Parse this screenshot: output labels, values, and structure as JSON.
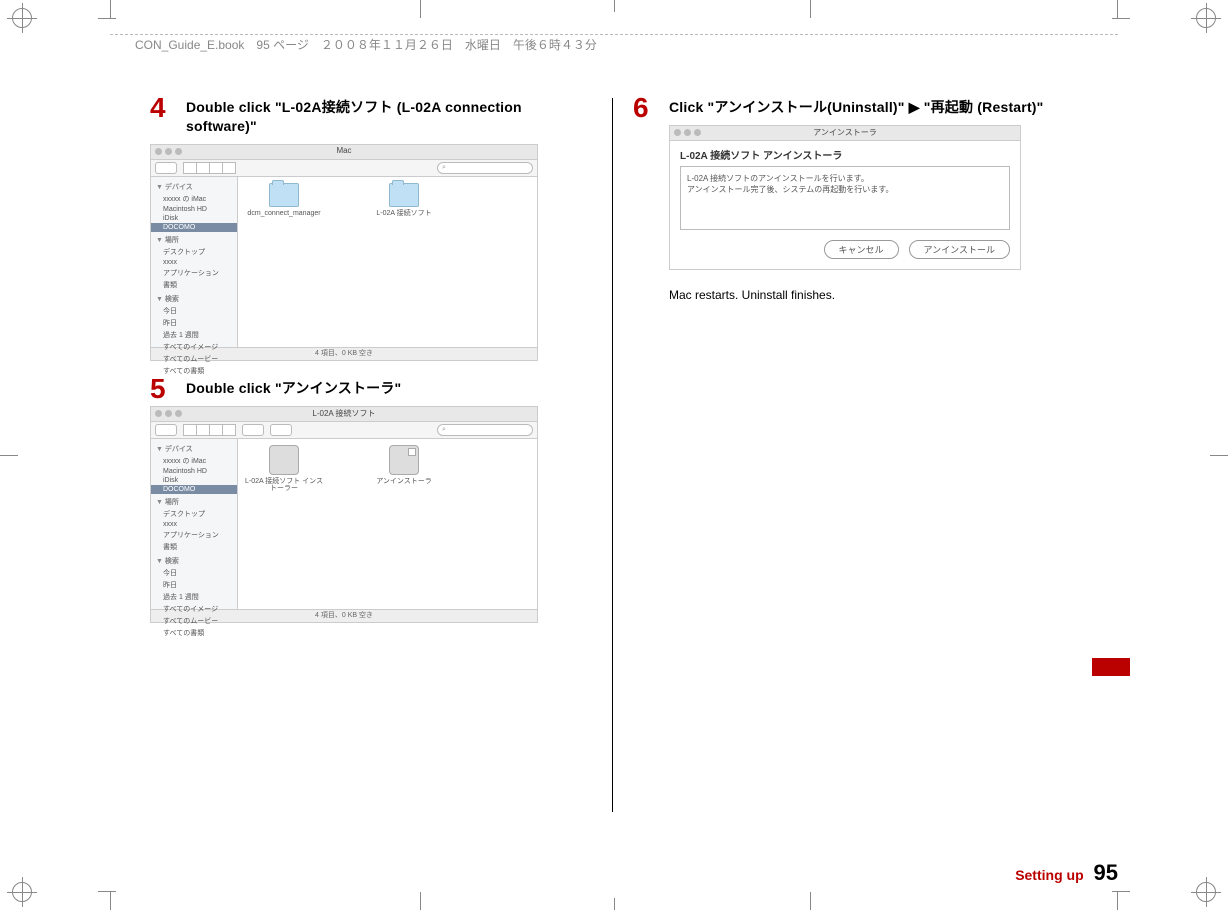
{
  "header_line": "CON_Guide_E.book　95 ページ　２００８年１１月２６日　水曜日　午後６時４３分",
  "steps": {
    "s4": {
      "num": "4",
      "text": "Double click \"L-02A接続ソフト (L-02A connection software)\""
    },
    "s5": {
      "num": "5",
      "text": "Double click \"アンインストーラ\""
    },
    "s6": {
      "num": "6",
      "text": "Click \"アンインストール(Uninstall)\" ▶ \"再起動 (Restart)\""
    }
  },
  "finderA": {
    "title": "Mac",
    "search_glyph": "⌕",
    "side": {
      "devices_hd": "▼ デバイス",
      "dev1": "xxxxx の iMac",
      "dev2": "Macintosh HD",
      "dev3": "iDisk",
      "dev4": "DOCOMO",
      "places_hd": "▼ 場所",
      "pl1": "デスクトップ",
      "pl2": "xxxx",
      "pl3": "アプリケーション",
      "pl4": "書類",
      "search_hd": "▼ 検索",
      "se1": "今日",
      "se2": "昨日",
      "se3": "過去 1 週間",
      "se4": "すべてのイメージ",
      "se5": "すべてのムービー",
      "se6": "すべての書類"
    },
    "icons": {
      "a": "dcm_connect_manager",
      "b": "L-02A 接続ソフト"
    },
    "status": "4 項目、0 KB 空き"
  },
  "finderB": {
    "title": "L-02A 接続ソフト",
    "icons": {
      "a": "L-02A 接続ソフト インストーラー",
      "b": "アンインストーラ"
    },
    "status": "4 項目、0 KB 空き"
  },
  "dialog": {
    "wintitle": "アンインストーラ",
    "heading": "L-02A 接続ソフト アンインストーラ",
    "line1": "L-02A 接続ソフトのアンインストールを行います。",
    "line2": "アンインストール完了後、システムの再起動を行います。",
    "cancel": "キャンセル",
    "ok": "アンインストール"
  },
  "note_after_6": "Mac restarts. Uninstall finishes.",
  "footer": {
    "section": "Setting up",
    "page": "95"
  }
}
